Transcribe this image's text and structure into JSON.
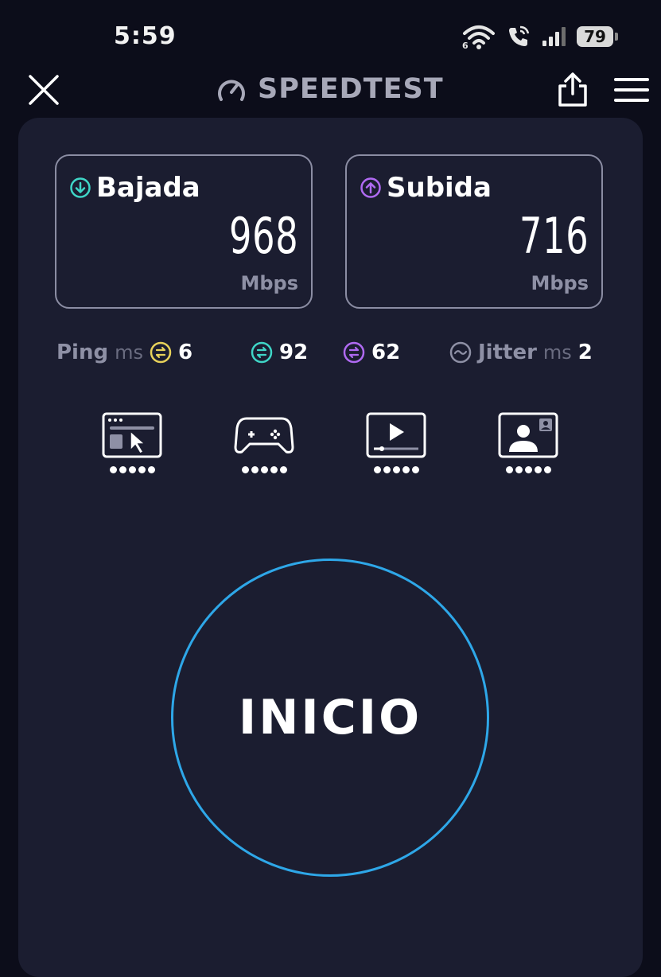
{
  "status_bar": {
    "time": "5:59",
    "battery_level": "79"
  },
  "header": {
    "app_title": "SPEEDTEST"
  },
  "download": {
    "label": "Bajada",
    "value": "968",
    "unit": "Mbps",
    "accent": "#3fd6c7"
  },
  "upload": {
    "label": "Subida",
    "value": "716",
    "unit": "Mbps",
    "accent": "#b06af2"
  },
  "metrics": {
    "ping_label": "Ping",
    "ping_unit": "ms",
    "ping_idle": "6",
    "ping_download": "92",
    "ping_upload": "62",
    "jitter_label": "Jitter",
    "jitter_unit": "ms",
    "jitter_value": "2",
    "idle_color": "#e8d25a"
  },
  "usage_icons": [
    "web-browsing-icon",
    "gaming-icon",
    "video-streaming-icon",
    "video-call-icon"
  ],
  "start_button": {
    "label": "INICIO",
    "ring_color": "#2ea7e8"
  }
}
